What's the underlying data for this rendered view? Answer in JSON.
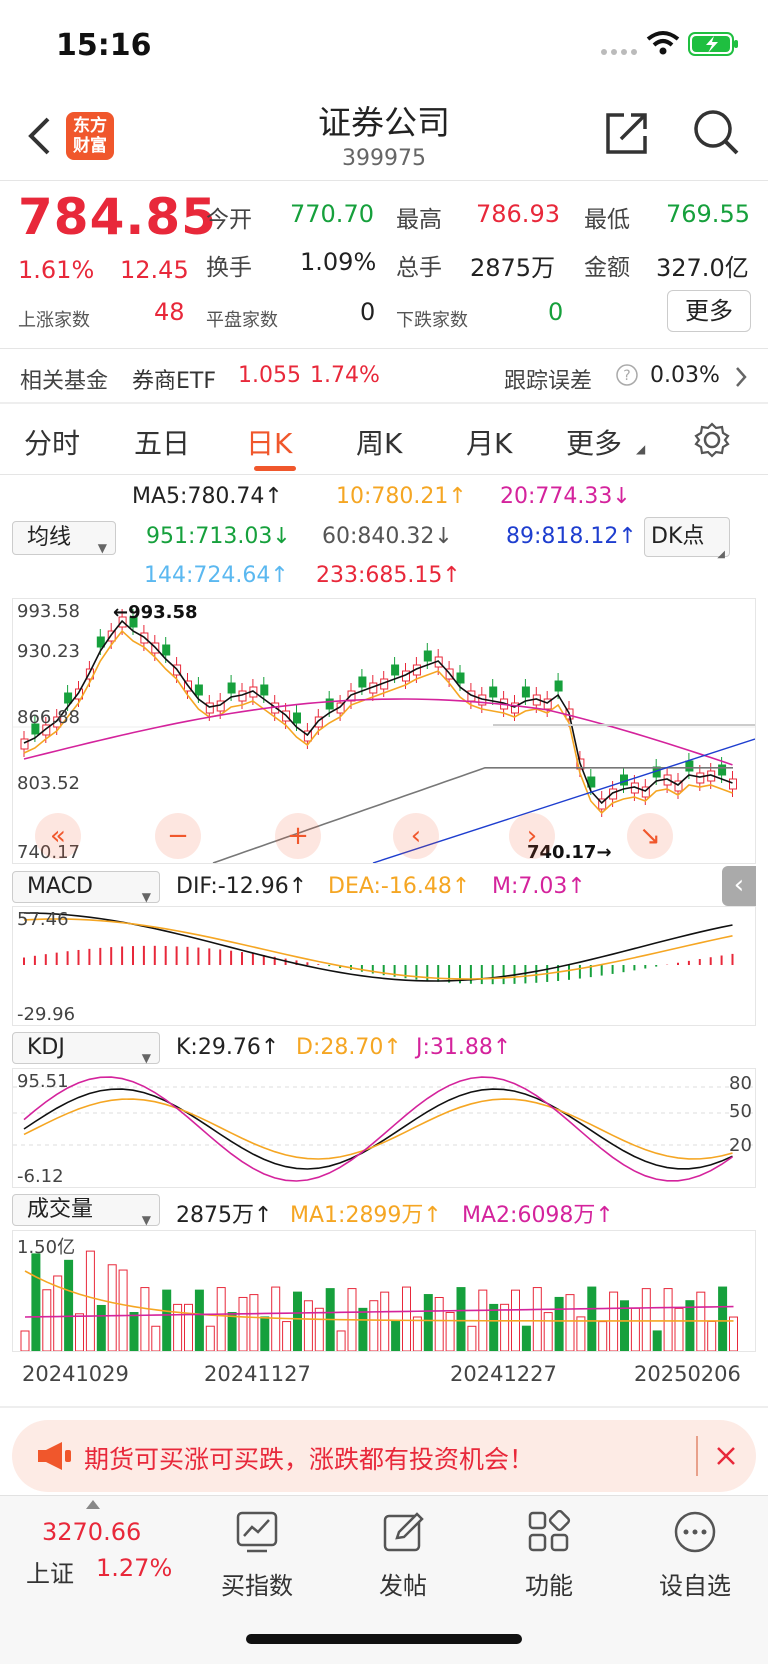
{
  "status_bar": {
    "time": "15:16"
  },
  "header": {
    "title": "证券公司",
    "code": "399975",
    "logo_text": "东方财富"
  },
  "quote": {
    "price": "784.85",
    "change_pct": "1.61%",
    "change_amt": "12.45",
    "open_label": "今开",
    "open": "770.70",
    "high_label": "最高",
    "high": "786.93",
    "low_label": "最低",
    "low": "769.55",
    "turnover_label": "换手",
    "turnover": "1.09%",
    "volume_label": "总手",
    "volume": "2875万",
    "amount_label": "金额",
    "amount": "327.0亿",
    "up_label": "上涨家数",
    "up_count": "48",
    "flat_label": "平盘家数",
    "flat_count": "0",
    "down_label": "下跌家数",
    "down_count": "0",
    "more_label": "更多"
  },
  "fund": {
    "label": "相关基金",
    "name": "券商ETF",
    "price": "1.055",
    "pct": "1.74%",
    "tracking_label": "跟踪误差",
    "tracking_value": "0.03%"
  },
  "tabs": [
    {
      "label": "分时"
    },
    {
      "label": "五日"
    },
    {
      "label": "日K"
    },
    {
      "label": "周K"
    },
    {
      "label": "月K"
    },
    {
      "label": "更多"
    }
  ],
  "ma_legend": {
    "selector": "均线",
    "ma5": "MA5:780.74↑",
    "ma10": "10:780.21↑",
    "ma20": "20:774.33↓",
    "ma951": "951:713.03↓",
    "ma60": "60:840.32↓",
    "ma89": "89:818.12↑",
    "ma144": "144:724.64↑",
    "ma233": "233:685.15↑",
    "dk_button": "DK点"
  },
  "kline": {
    "y_labels": [
      "993.58",
      "930.23",
      "866.88",
      "803.52",
      "740.17"
    ],
    "high_marker": "←993.58",
    "low_marker": "740.17→"
  },
  "macd": {
    "selector": "MACD",
    "dif": "DIF:-12.96↑",
    "dea": "DEA:-16.48↑",
    "m": "M:7.03↑",
    "y_top": "57.46",
    "y_bottom": "-29.96"
  },
  "kdj": {
    "selector": "KDJ",
    "k": "K:29.76↑",
    "d": "D:28.70↑",
    "j": "J:31.88↑",
    "y_top": "95.51",
    "y_bottom": "-6.12",
    "ref_levels": [
      "80",
      "50",
      "20"
    ]
  },
  "volume": {
    "selector": "成交量",
    "value": "2875万↑",
    "ma1": "MA1:2899万↑",
    "ma2": "MA2:6098万↑",
    "y_top": "1.50亿",
    "dates": [
      "20241029",
      "20241127",
      "20241227",
      "20250206"
    ]
  },
  "banner": {
    "text": "期货可买涨可买跌，涨跌都有投资机会！"
  },
  "bottom_nav": {
    "index_value": "3270.66",
    "index_name": "上证",
    "index_pct": "1.27%",
    "items": [
      {
        "label": "买指数"
      },
      {
        "label": "发帖"
      },
      {
        "label": "功能"
      },
      {
        "label": "设自选"
      }
    ]
  },
  "colors": {
    "up": "#e8283a",
    "down": "#16a03c",
    "accent": "#f0572c"
  }
}
